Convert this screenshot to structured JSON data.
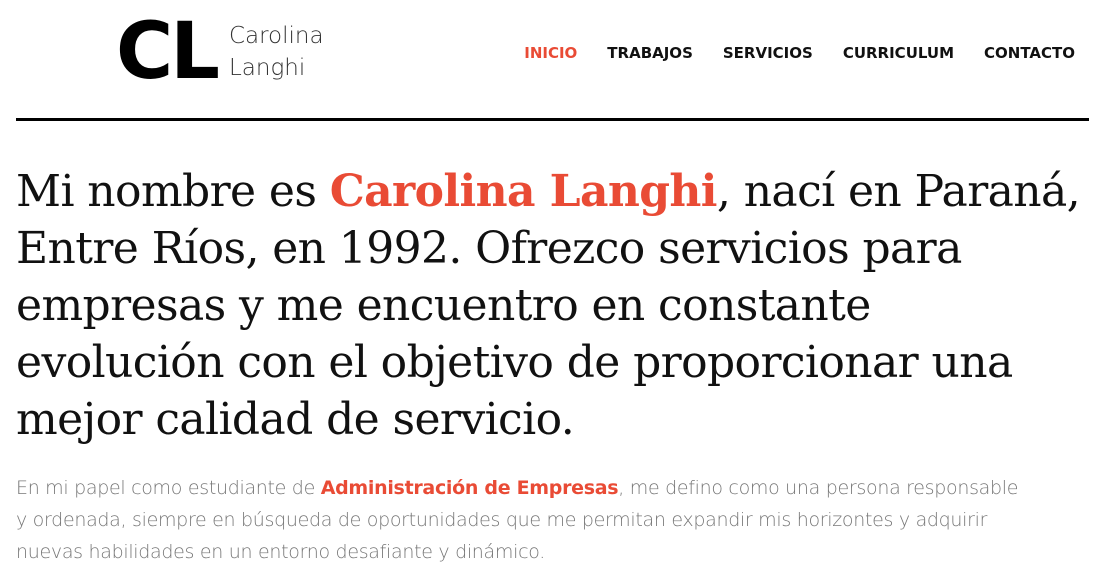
{
  "colors": {
    "accent": "#e94b35",
    "text": "#111111",
    "muted": "#777777"
  },
  "logo": {
    "mark": "CL",
    "first_name": "Carolina",
    "last_name": "Langhi"
  },
  "nav": {
    "items": [
      {
        "label": "INICIO",
        "active": true
      },
      {
        "label": "TRABAJOS",
        "active": false
      },
      {
        "label": "SERVICIOS",
        "active": false
      },
      {
        "label": "CURRICULUM",
        "active": false
      },
      {
        "label": "CONTACTO",
        "active": false
      }
    ]
  },
  "hero": {
    "headline_prefix": "Mi nombre es ",
    "headline_name": "Carolina Langhi",
    "headline_suffix": ", nací en Paraná, Entre Ríos, en 1992. Ofrezco servicios para empresas y me encuentro en constante evolución con el objetivo de proporcionar una mejor calidad de servicio.",
    "intro_prefix": "En mi papel como estudiante de ",
    "intro_highlight": "Administración de Empresas",
    "intro_suffix": ", me defino como una persona responsable y ordenada, siempre en búsqueda de oportunidades que me permitan expandir mis horizontes y adquirir nuevas habilidades en un entorno desafiante y dinámico."
  }
}
